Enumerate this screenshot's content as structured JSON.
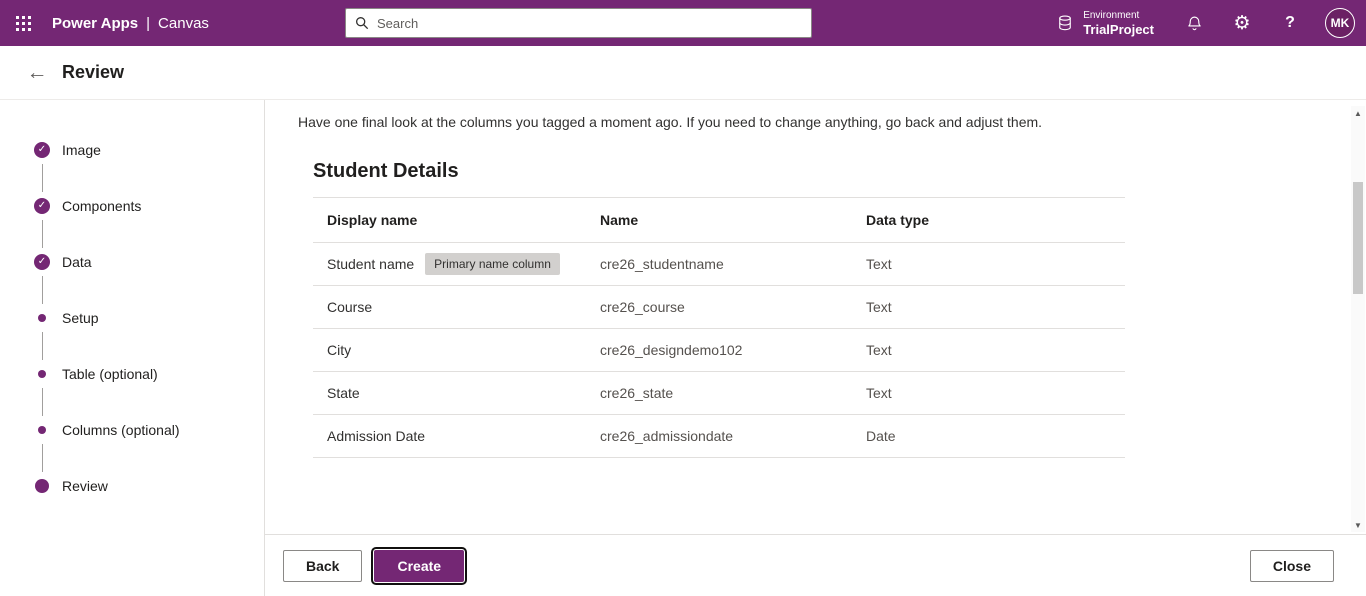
{
  "topbar": {
    "app_title": "Power Apps",
    "separator": "|",
    "app_subtitle": "Canvas",
    "search_placeholder": "Search",
    "environment_label": "Environment",
    "environment_name": "TrialProject",
    "avatar_initials": "MK"
  },
  "header": {
    "title": "Review"
  },
  "wizard": {
    "steps": [
      {
        "label": "Image",
        "state": "complete"
      },
      {
        "label": "Components",
        "state": "complete"
      },
      {
        "label": "Data",
        "state": "complete"
      },
      {
        "label": "Setup",
        "state": "pending"
      },
      {
        "label": "Table (optional)",
        "state": "pending"
      },
      {
        "label": "Columns (optional)",
        "state": "pending"
      },
      {
        "label": "Review",
        "state": "current"
      }
    ]
  },
  "main": {
    "intro": "Have one final look at the columns you tagged a moment ago. If you need to change anything, go back and adjust them.",
    "section_title": "Student Details",
    "table": {
      "headers": [
        "Display name",
        "Name",
        "Data type"
      ],
      "rows": [
        {
          "display_name": "Student name",
          "badge": "Primary name column",
          "name": "cre26_studentname",
          "data_type": "Text"
        },
        {
          "display_name": "Course",
          "name": "cre26_course",
          "data_type": "Text"
        },
        {
          "display_name": "City",
          "name": "cre26_designdemo102",
          "data_type": "Text"
        },
        {
          "display_name": "State",
          "name": "cre26_state",
          "data_type": "Text"
        },
        {
          "display_name": "Admission Date",
          "name": "cre26_admissiondate",
          "data_type": "Date"
        }
      ]
    }
  },
  "footer": {
    "back_label": "Back",
    "create_label": "Create",
    "close_label": "Close"
  },
  "icons": {
    "check": "✓",
    "back_arrow": "←",
    "gear": "⚙",
    "help": "?",
    "scroll_up": "▲",
    "scroll_down": "▼"
  },
  "colors": {
    "accent_purple": "#742774"
  }
}
